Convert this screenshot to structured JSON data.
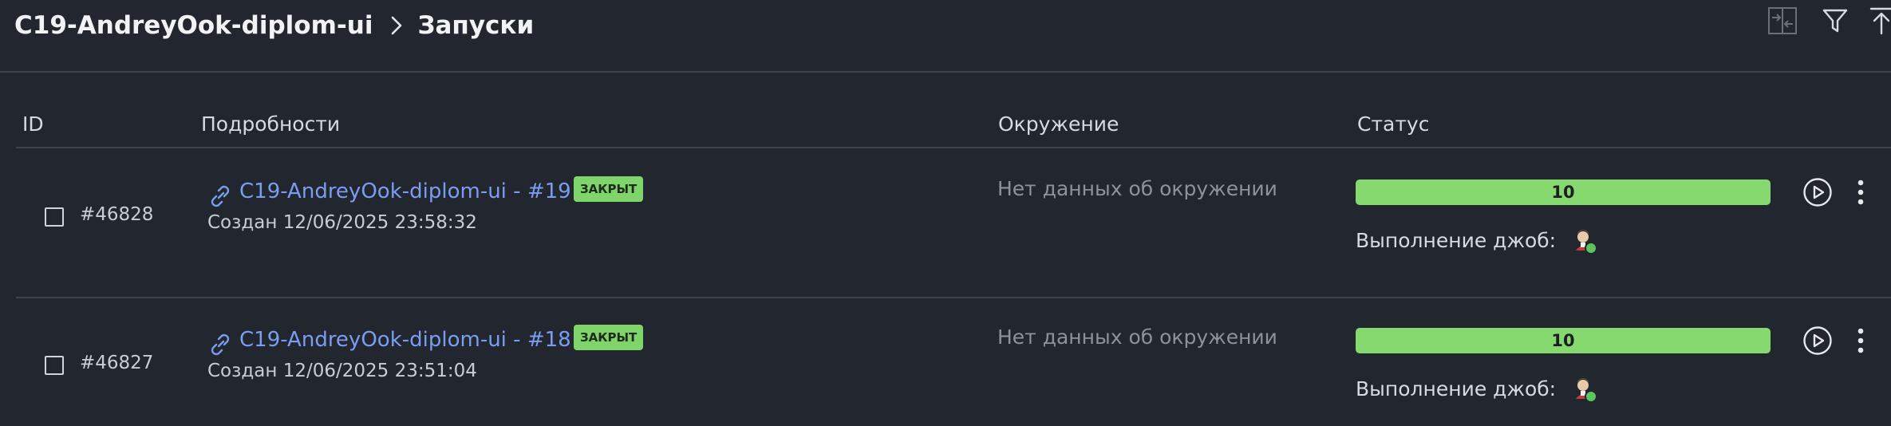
{
  "header": {
    "project": "C19-AndreyOok-diplom-ui",
    "separator_icon": "chevron-right-icon",
    "page": "Запуски",
    "tools": [
      "compare-icon",
      "filter-icon",
      "upload-icon"
    ]
  },
  "table": {
    "columns": [
      "ID",
      "Подробности",
      "Окружение",
      "Статус"
    ],
    "rows": [
      {
        "id": "#46828",
        "title": "C19-AndreyOok-diplom-ui - #19",
        "badge": "ЗАКРЫТ",
        "created": "Создан 12/06/2025 23:58:32",
        "environment": "Нет данных об окружении",
        "progress": "10",
        "jobs_label": "Выполнение джоб:"
      },
      {
        "id": "#46827",
        "title": "C19-AndreyOok-diplom-ui - #18",
        "badge": "ЗАКРЫТ",
        "created": "Создан 12/06/2025 23:51:04",
        "environment": "Нет данных об окружении",
        "progress": "10",
        "jobs_label": "Выполнение джоб:"
      }
    ]
  },
  "colors": {
    "background": "#22262e",
    "link": "#7b9df0",
    "success": "#86d96f",
    "divider": "#3d424b"
  }
}
